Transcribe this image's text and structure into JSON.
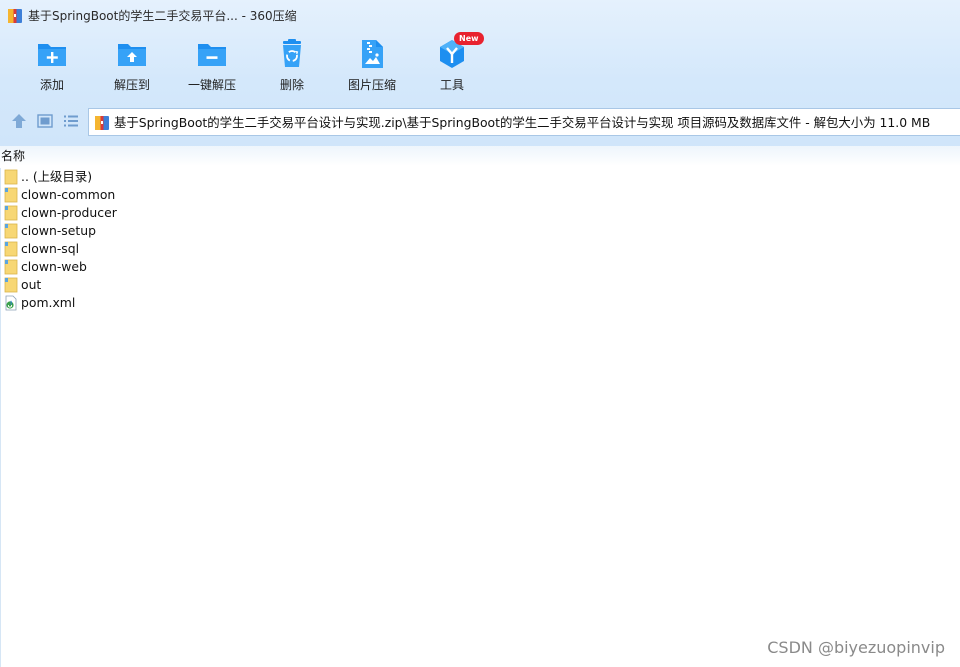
{
  "window": {
    "title": "基于SpringBoot的学生二手交易平台... - 360压缩"
  },
  "toolbar": {
    "buttons": [
      {
        "label": "添加",
        "icon": "add-folder-icon"
      },
      {
        "label": "解压到",
        "icon": "extract-to-folder-icon"
      },
      {
        "label": "一键解压",
        "icon": "one-click-extract-icon"
      },
      {
        "label": "删除",
        "icon": "recycle-bin-icon"
      },
      {
        "label": "图片压缩",
        "icon": "image-compress-icon"
      },
      {
        "label": "工具",
        "icon": "tools-cube-icon",
        "badge": "New"
      }
    ]
  },
  "address_bar": {
    "path": "基于SpringBoot的学生二手交易平台设计与实现.zip\\基于SpringBoot的学生二手交易平台设计与实现 项目源码及数据库文件 - 解包大小为 11.0 MB"
  },
  "file_list": {
    "column_name": "名称",
    "items": [
      {
        "name": ".. (上级目录)",
        "type": "parent-folder"
      },
      {
        "name": "clown-common",
        "type": "folder"
      },
      {
        "name": "clown-producer",
        "type": "folder"
      },
      {
        "name": "clown-setup",
        "type": "folder"
      },
      {
        "name": "clown-sql",
        "type": "folder"
      },
      {
        "name": "clown-web",
        "type": "folder"
      },
      {
        "name": "out",
        "type": "folder"
      },
      {
        "name": "pom.xml",
        "type": "xml-file"
      }
    ]
  },
  "watermark": "CSDN @biyezuopinvip",
  "colors": {
    "header_bg": "#d4e8fb",
    "icon_blue": "#1e8ff0",
    "badge_red": "#e8222f",
    "folder_yellow": "#f7d774"
  }
}
